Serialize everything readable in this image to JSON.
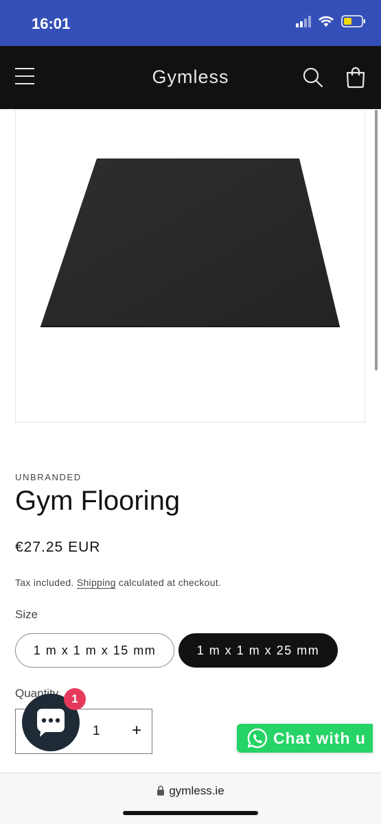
{
  "status_bar": {
    "time": "16:01",
    "background_color": "#3450b8",
    "icons": [
      "signal-icon",
      "wifi-icon",
      "battery-icon"
    ],
    "battery_color": "#f5d90a"
  },
  "header": {
    "brand": "Gymless",
    "background_color": "#111111",
    "icons": [
      "menu-icon",
      "search-icon",
      "cart-icon"
    ]
  },
  "product": {
    "vendor": "UNBRANDED",
    "title": "Gym Flooring",
    "price": "€27.25 EUR",
    "tax_prefix": "Tax included. ",
    "shipping_link": "Shipping",
    "tax_suffix": " calculated at checkout.",
    "size_label": "Size",
    "size_options": [
      {
        "label": "1 m x 1 m x 15 mm",
        "selected": false
      },
      {
        "label": "1 m x 1 m x 25 mm",
        "selected": true
      }
    ],
    "quantity_label": "Quantity",
    "quantity_value": "1",
    "quantity_plus": "+"
  },
  "chat": {
    "badge_count": "1",
    "icon": "chat-icon",
    "bubble_color": "#1e2a36",
    "badge_color": "#e63a5d"
  },
  "whatsapp": {
    "label": "Chat with u",
    "icon": "whatsapp-icon",
    "color": "#25d366"
  },
  "browser": {
    "url": "gymless.ie",
    "icon": "lock-icon"
  }
}
